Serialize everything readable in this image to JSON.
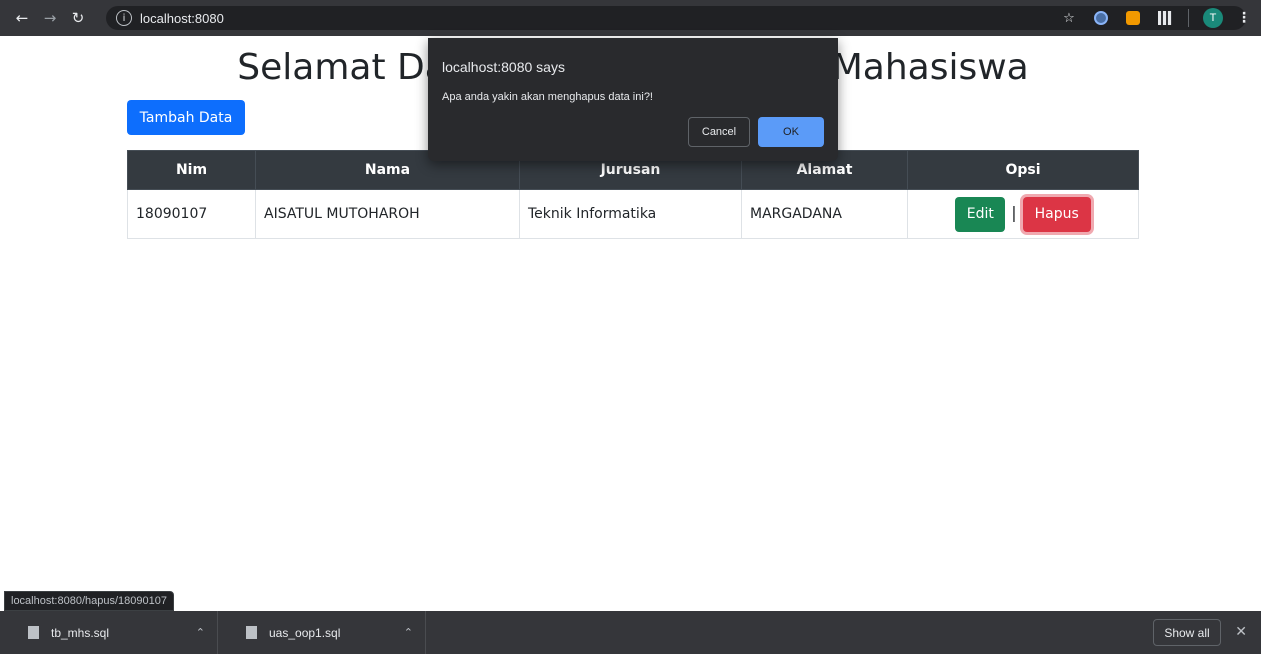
{
  "browser": {
    "url": "localhost:8080",
    "avatar_initial": "T"
  },
  "page": {
    "title": "Selamat Datang di Aplikasi Data Mahasiswa",
    "add_button": "Tambah Data",
    "table": {
      "headers": [
        "Nim",
        "Nama",
        "Jurusan",
        "Alamat",
        "Opsi"
      ],
      "rows": [
        {
          "nim": "18090107",
          "nama": "AISATUL MUTOHAROH",
          "jurusan": "Teknik Informatika",
          "alamat": "MARGADANA",
          "edit": "Edit",
          "separator": "|",
          "hapus": "Hapus"
        }
      ]
    }
  },
  "dialog": {
    "title": "localhost:8080 says",
    "message": "Apa anda yakin akan menghapus data ini?!",
    "cancel": "Cancel",
    "ok": "OK"
  },
  "status_url": "localhost:8080/hapus/18090107",
  "downloads": {
    "items": [
      {
        "name": "tb_mhs.sql"
      },
      {
        "name": "uas_oop1.sql"
      }
    ],
    "show_all": "Show all"
  },
  "icons": {
    "back": "arrow-left-icon",
    "forward": "arrow-right-icon",
    "reload": "reload-icon",
    "info": "info-icon",
    "star": "star-icon",
    "chevron": "chevron-up-icon",
    "close": "close-icon"
  }
}
